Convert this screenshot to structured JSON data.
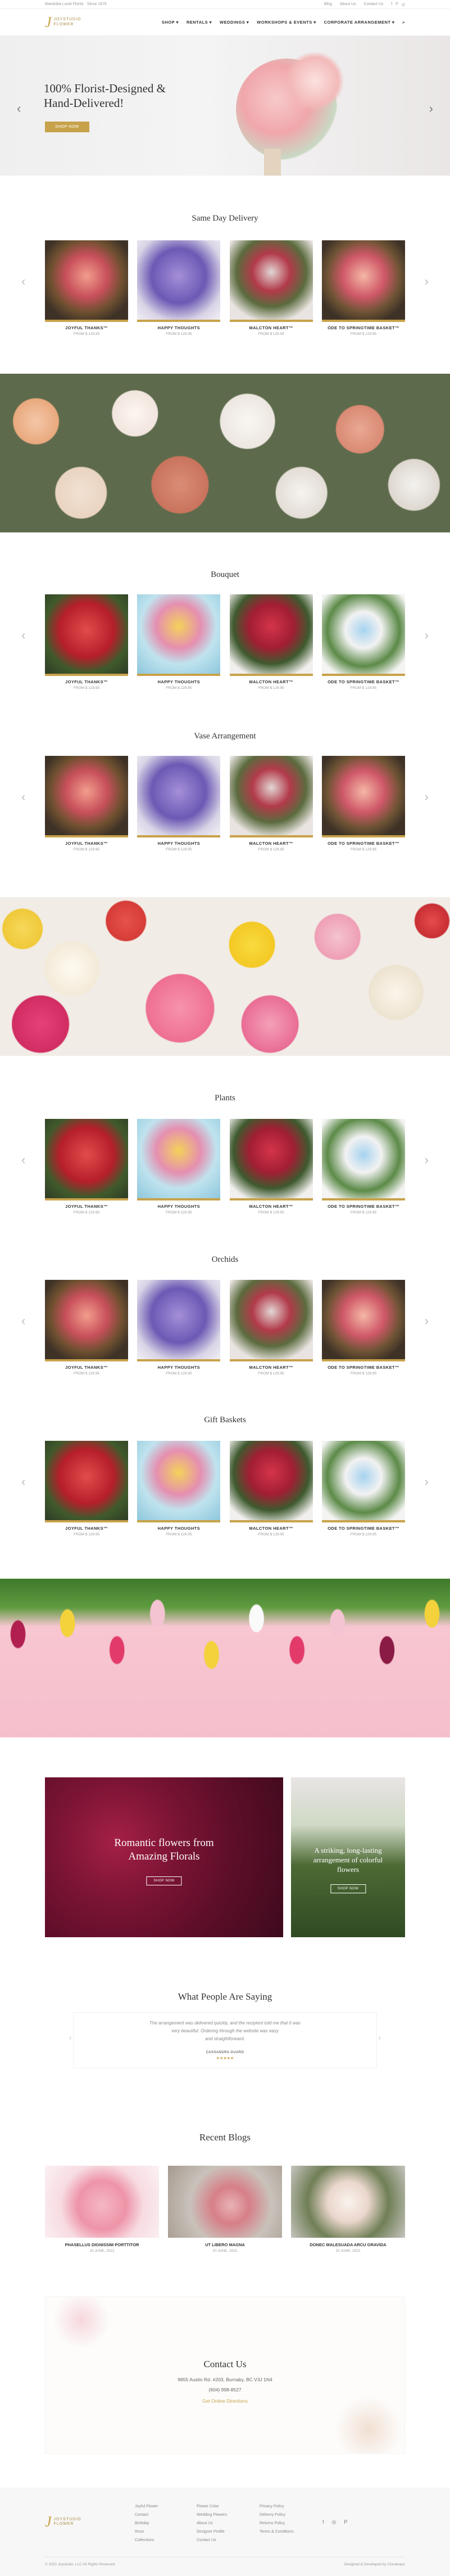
{
  "topbar": {
    "left": "Manitoba Local Florist · Since 1976",
    "links": [
      "Blog",
      "About Us",
      "Contact Us"
    ]
  },
  "brand": {
    "mark": "J",
    "line1": "JOYSTUDIO",
    "line2": "FLOWER"
  },
  "menu": [
    "SHOP ▾",
    "RENTALS ▾",
    "WEDDINGS ▾",
    "WORKSHOPS & EVENTS ▾",
    "CORPORATE ARRANGEMENT ▾"
  ],
  "hero": {
    "line1": "100% Florist-Designed &",
    "line2": "Hand-Delivered!",
    "button": "SHOP NOW"
  },
  "sections": [
    {
      "title": "Same Day Delivery",
      "products": [
        {
          "name": "JOYFUL THANKS™",
          "price": "FROM $ 129.95"
        },
        {
          "name": "HAPPY THOUGHTS",
          "price": "FROM $ 129.95"
        },
        {
          "name": "MALCTON HEART™",
          "price": "FROM $ 129.95"
        },
        {
          "name": "ODE TO SPRINGTIME BASKET™",
          "price": "FROM $ 129.95"
        }
      ]
    },
    {
      "title": "Bouquet",
      "products": [
        {
          "name": "JOYFUL THANKS™",
          "price": "FROM $ 129.95"
        },
        {
          "name": "HAPPY THOUGHTS",
          "price": "FROM $ 129.95"
        },
        {
          "name": "MALCTON HEART™",
          "price": "FROM $ 129.95"
        },
        {
          "name": "ODE TO SPRINGTIME BASKET™",
          "price": "FROM $ 129.95"
        }
      ]
    },
    {
      "title": "Vase Arrangement",
      "products": [
        {
          "name": "JOYFUL THANKS™",
          "price": "FROM $ 129.95"
        },
        {
          "name": "HAPPY THOUGHTS",
          "price": "FROM $ 129.95"
        },
        {
          "name": "MALCTON HEART™",
          "price": "FROM $ 129.95"
        },
        {
          "name": "ODE TO SPRINGTIME BASKET™",
          "price": "FROM $ 129.95"
        }
      ]
    },
    {
      "title": "Plants",
      "products": [
        {
          "name": "JOYFUL THANKS™",
          "price": "FROM $ 129.95"
        },
        {
          "name": "HAPPY THOUGHTS",
          "price": "FROM $ 129.95"
        },
        {
          "name": "MALCTON HEART™",
          "price": "FROM $ 129.95"
        },
        {
          "name": "ODE TO SPRINGTIME BASKET™",
          "price": "FROM $ 129.95"
        }
      ]
    },
    {
      "title": "Orchids",
      "products": [
        {
          "name": "JOYFUL THANKS™",
          "price": "FROM $ 129.95"
        },
        {
          "name": "HAPPY THOUGHTS",
          "price": "FROM $ 129.95"
        },
        {
          "name": "MALCTON HEART™",
          "price": "FROM $ 129.95"
        },
        {
          "name": "ODE TO SPRINGTIME BASKET™",
          "price": "FROM $ 129.95"
        }
      ]
    },
    {
      "title": "Gift Baskets",
      "products": [
        {
          "name": "JOYFUL THANKS™",
          "price": "FROM $ 129.95"
        },
        {
          "name": "HAPPY THOUGHTS",
          "price": "FROM $ 129.95"
        },
        {
          "name": "MALCTON HEART™",
          "price": "FROM $ 129.95"
        },
        {
          "name": "ODE TO SPRINGTIME BASKET™",
          "price": "FROM $ 129.95"
        }
      ]
    }
  ],
  "promos": [
    {
      "line1": "Romantic flowers from",
      "line2": "Amazing Florals",
      "button": "SHOP NOW"
    },
    {
      "line1": "A striking, long-lasting",
      "line2": "arrangement of colorful",
      "line3": "flowers",
      "button": "SHOP NOW"
    }
  ],
  "testimonials": {
    "title": "What People Are Saying",
    "quote1": "The arrangement was delivered quickly, and the recipient told me that it was",
    "quote2": "very beautiful. Ordering through the website was easy",
    "quote3": "and straightforward.",
    "author": "CASSANDRA GUARD",
    "stars": "★★★★★"
  },
  "blogs": {
    "title": "Recent Blogs",
    "items": [
      {
        "name": "PHASELLUS DIGNISSIM PORTTITOR",
        "date": "20 JUNE, 2022"
      },
      {
        "name": "UT LIBERO MAGNA",
        "date": "20 JUNE, 2022"
      },
      {
        "name": "DONEC MALESUADA ARCU GRAVIDA",
        "date": "20 JUNE, 2022"
      }
    ]
  },
  "contact": {
    "title": "Contact Us",
    "address": "9855 Austin Rd. #203, Burnaby, BC V3J 1N4",
    "phone": "(604) 998-8527",
    "email": "Get Online Directions"
  },
  "footer": {
    "col1": [
      "Joyful Flower",
      "Contact",
      "Birthday",
      "Rose",
      "Collections"
    ],
    "col2": [
      "Flower Color",
      "Wedding Flowers",
      "About Us",
      "Designer Profile",
      "Contact Us"
    ],
    "col3": [
      "Privacy Policy",
      "Delivery Policy",
      "Returns Policy",
      "Terms & Conditions"
    ],
    "copyright": "© 2022 Joystudio, LLC All Rights Reserved",
    "credit": "Designed & Developed by Cloudways"
  },
  "colors": {
    "gold": "#c8a24a"
  }
}
